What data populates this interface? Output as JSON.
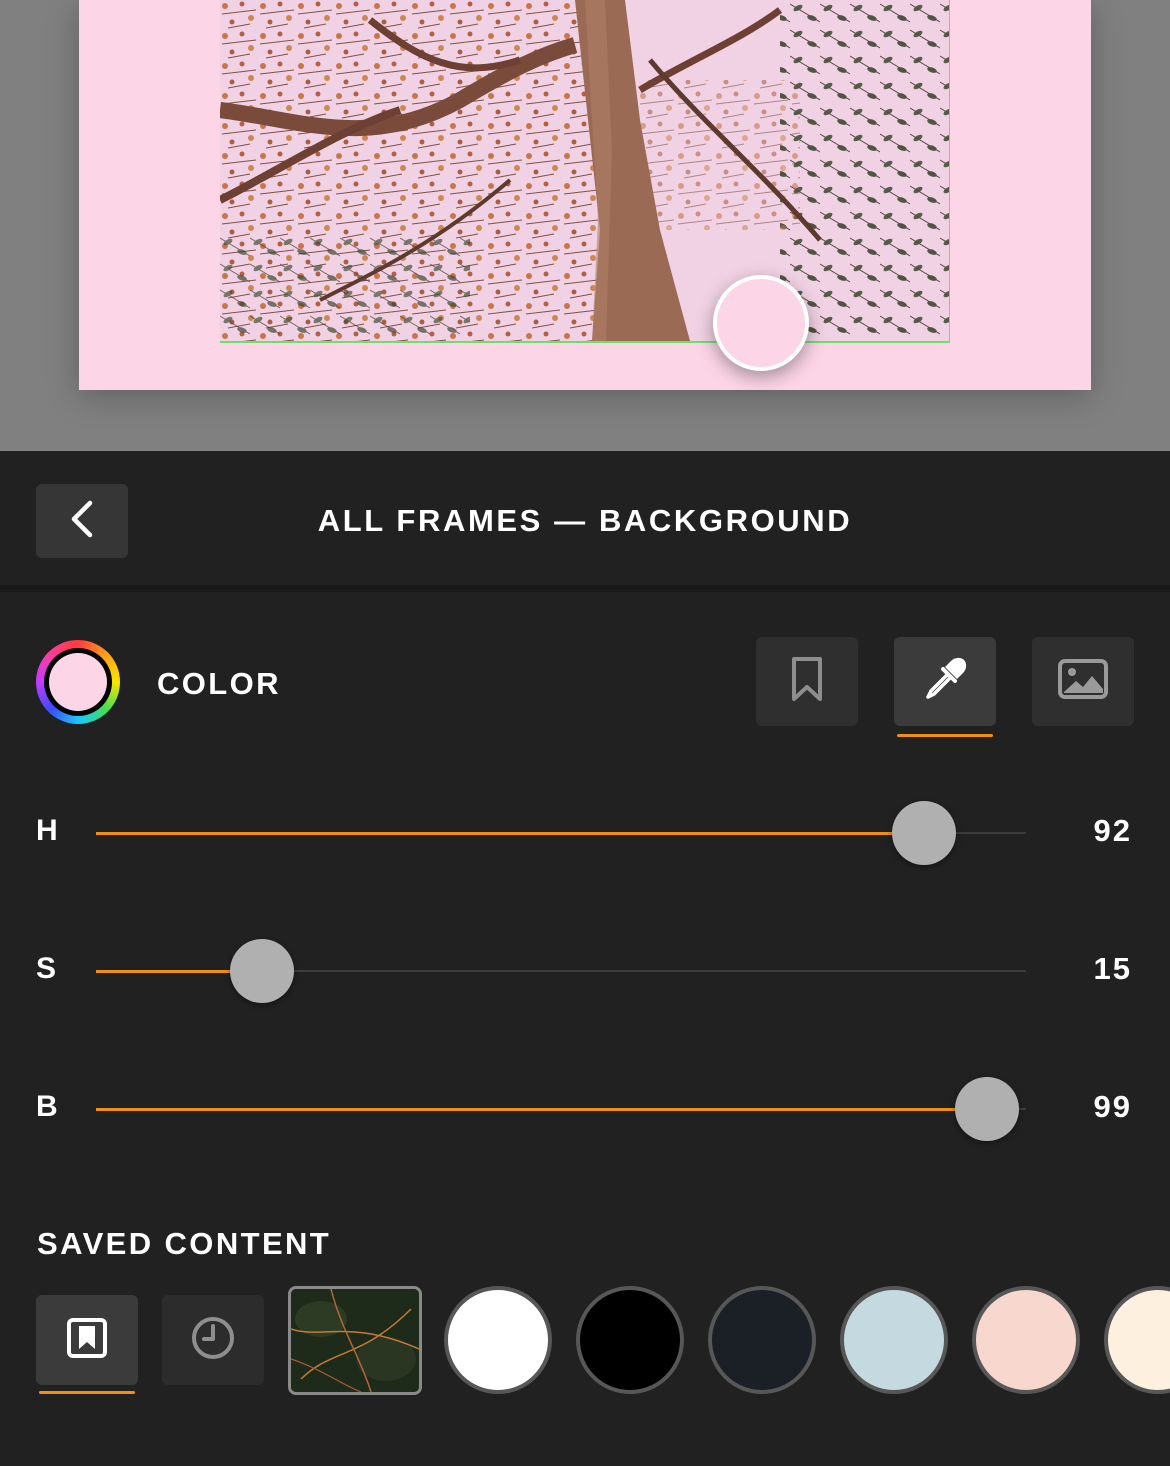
{
  "header": {
    "title": "ALL FRAMES — BACKGROUND"
  },
  "color_section": {
    "label": "COLOR",
    "current_color": "#fcd5e7",
    "modes": [
      {
        "name": "bookmark-icon",
        "active": false
      },
      {
        "name": "eyedropper-icon",
        "active": true
      },
      {
        "name": "image-icon",
        "active": false
      }
    ],
    "accent": "#f0900e"
  },
  "sliders": [
    {
      "letter": "H",
      "value": "92",
      "fraction": 0.89
    },
    {
      "letter": "S",
      "value": "15",
      "fraction": 0.178
    },
    {
      "letter": "B",
      "value": "99",
      "fraction": 0.958
    }
  ],
  "saved_content": {
    "label": "SAVED CONTENT",
    "tabs": [
      {
        "name": "saved-bookmark-icon",
        "active": true
      },
      {
        "name": "history-clock-icon",
        "active": false
      }
    ],
    "swatches": [
      "#ffffff",
      "#000000",
      "#1b1f26",
      "#c4dae0",
      "#f8d7ce",
      "#fdf0de"
    ]
  }
}
